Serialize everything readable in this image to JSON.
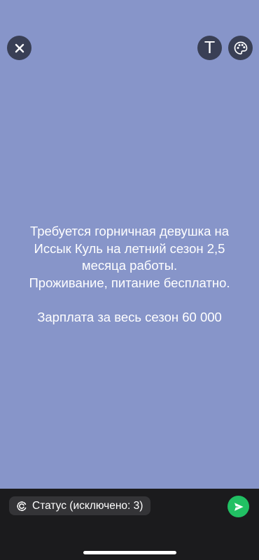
{
  "toolbar": {
    "close_icon": "close-icon",
    "text_tool_label": "T",
    "palette_icon": "palette-icon"
  },
  "status": {
    "line1": "Требуется горничная девушка на",
    "line2": "Иссык Куль на летний сезон 2,5",
    "line3": "месяца работы.",
    "line4": "Проживание, питание бесплатно.",
    "line5": "Зарплата за весь сезон 60 000",
    "background_color": "#8795c9",
    "text_color": "#ffffff"
  },
  "composer": {
    "privacy_label": "Статус (исключено: 3)",
    "privacy_icon": "status-ring-icon",
    "send_icon": "send-icon",
    "send_color": "#21c063"
  }
}
